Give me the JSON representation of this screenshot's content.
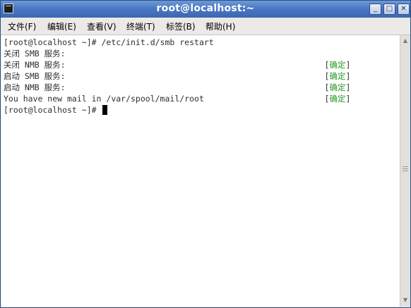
{
  "window": {
    "title": "root@localhost:~",
    "controls": {
      "minimize": "_",
      "maximize": "□",
      "close": "✕"
    }
  },
  "menu": [
    {
      "label": "文件(F)"
    },
    {
      "label": "编辑(E)"
    },
    {
      "label": "查看(V)"
    },
    {
      "label": "终端(T)"
    },
    {
      "label": "标签(B)"
    },
    {
      "label": "帮助(H)"
    }
  ],
  "terminal": {
    "lines": [
      "[root@localhost ~]# /etc/init.d/smb restart",
      "关闭 SMB 服务:",
      "关闭 NMB 服务:",
      "启动 SMB 服务:",
      "启动 NMB 服务:",
      "You have new mail in /var/spool/mail/root",
      "[root@localhost ~]# "
    ],
    "status": {
      "open": "[",
      "text": "确定",
      "close": "]"
    }
  },
  "colors": {
    "title_bar": "#4b78c4",
    "status_ok": "#2b9a2b",
    "terminal_text": "#2f2f2f"
  }
}
